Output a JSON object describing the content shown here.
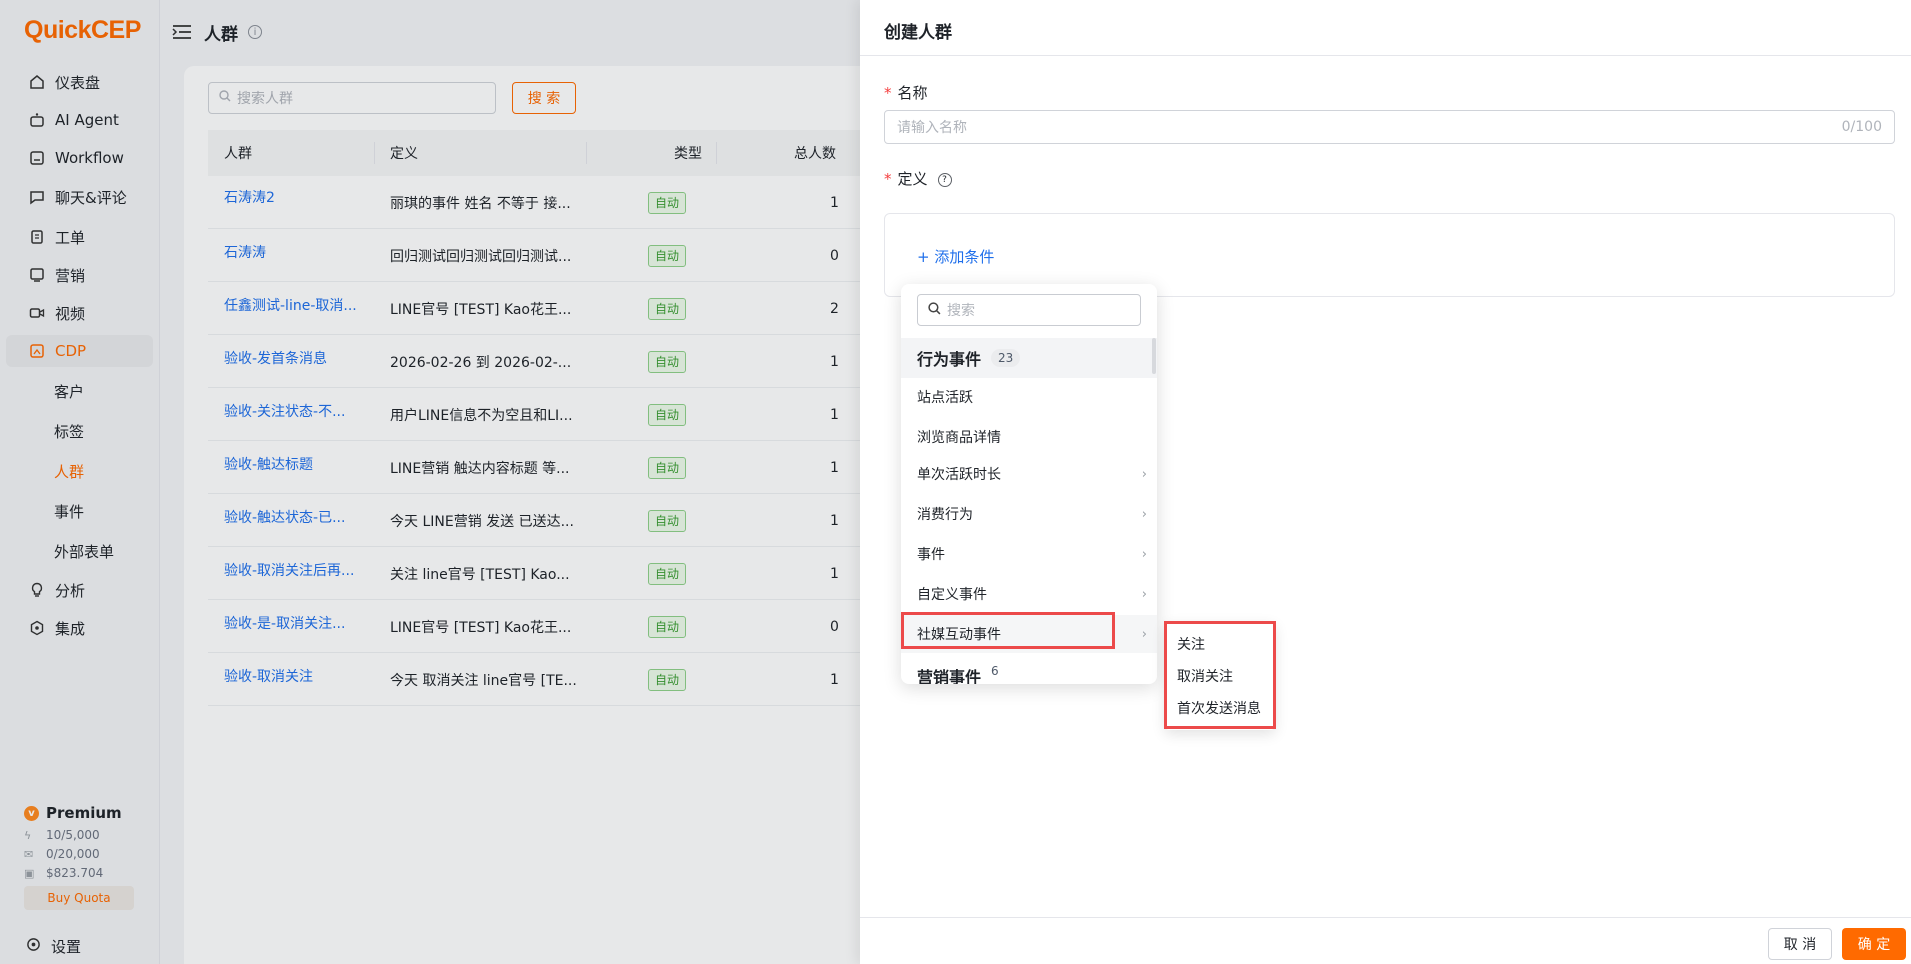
{
  "app": {
    "logo": "QuickCEP"
  },
  "sidebar": {
    "items": [
      {
        "label": "仪表盘",
        "icon": "home-icon"
      },
      {
        "label": "AI Agent",
        "icon": "robot-icon"
      },
      {
        "label": "Workflow",
        "icon": "workflow-icon"
      },
      {
        "label": "聊天&评论",
        "icon": "chat-icon"
      },
      {
        "label": "工单",
        "icon": "ticket-icon"
      },
      {
        "label": "营销",
        "icon": "marketing-icon"
      },
      {
        "label": "视频",
        "icon": "video-icon"
      },
      {
        "label": "CDP",
        "icon": "cdp-icon"
      },
      {
        "label": "分析",
        "icon": "bulb-icon"
      },
      {
        "label": "集成",
        "icon": "integration-icon"
      }
    ],
    "cdp_sub": [
      {
        "label": "客户"
      },
      {
        "label": "标签"
      },
      {
        "label": "人群"
      },
      {
        "label": "事件"
      },
      {
        "label": "外部表单"
      }
    ],
    "premium": {
      "title": "Premium",
      "q1": "10/5,000",
      "q2": "0/20,000",
      "q3": "$823.704",
      "buy": "Buy Quota"
    },
    "settings": "设置"
  },
  "header": {
    "title": "人群"
  },
  "list": {
    "search_placeholder": "搜索人群",
    "search_button": "搜 索",
    "columns": {
      "name": "人群",
      "definition": "定义",
      "type": "类型",
      "total": "总人数"
    },
    "rows": [
      {
        "name": "石涛涛2",
        "definition": "丽琪的事件 姓名 不等于 接...",
        "type": "自动",
        "total": "1"
      },
      {
        "name": "石涛涛",
        "definition": "回归测试回归测试回归测试...",
        "type": "自动",
        "total": "0"
      },
      {
        "name": "任鑫测试-line-取消...",
        "definition": "LINE官号 [TEST] Kao花王...",
        "type": "自动",
        "total": "2"
      },
      {
        "name": "验收-发首条消息",
        "definition": "2026-02-26 到 2026-02-...",
        "type": "自动",
        "total": "1"
      },
      {
        "name": "验收-关注状态-不...",
        "definition": "用户LINE信息不为空且和LI...",
        "type": "自动",
        "total": "1"
      },
      {
        "name": "验收-触达标题",
        "definition": "LINE营销 触达内容标题 等...",
        "type": "自动",
        "total": "1"
      },
      {
        "name": "验收-触达状态-已...",
        "definition": "今天 LINE营销 发送 已送达...",
        "type": "自动",
        "total": "1"
      },
      {
        "name": "验收-取消关注后再...",
        "definition": "关注 line官号 [TEST] Kao...",
        "type": "自动",
        "total": "1"
      },
      {
        "name": "验收-是-取消关注...",
        "definition": "LINE官号 [TEST] Kao花王...",
        "type": "自动",
        "total": "0"
      },
      {
        "name": "验收-取消关注",
        "definition": "今天 取消关注 line官号 [TE...",
        "type": "自动",
        "total": "1"
      }
    ]
  },
  "drawer": {
    "title": "创建人群",
    "name_label": "名称",
    "name_placeholder": "请输入名称",
    "name_counter": "0/100",
    "definition_label": "定义",
    "add_condition": "+ 添加条件",
    "cancel": "取 消",
    "confirm": "确 定"
  },
  "dropdown": {
    "search_placeholder": "搜索",
    "group1": {
      "label": "行为事件",
      "count": "23"
    },
    "items": [
      {
        "label": "站点活跃",
        "chevron": false
      },
      {
        "label": "浏览商品详情",
        "chevron": false
      },
      {
        "label": "单次活跃时长",
        "chevron": true
      },
      {
        "label": "消费行为",
        "chevron": true
      },
      {
        "label": "事件",
        "chevron": true
      },
      {
        "label": "自定义事件",
        "chevron": true
      },
      {
        "label": "社媒互动事件",
        "chevron": true
      }
    ],
    "group2": {
      "label": "营销事件",
      "count": "6"
    }
  },
  "submenu": {
    "items": [
      "关注",
      "取消关注",
      "首次发送消息"
    ]
  },
  "colors": {
    "accent": "#ff6a00",
    "link": "#1f6feb",
    "highlight": "#ec4a4a"
  }
}
